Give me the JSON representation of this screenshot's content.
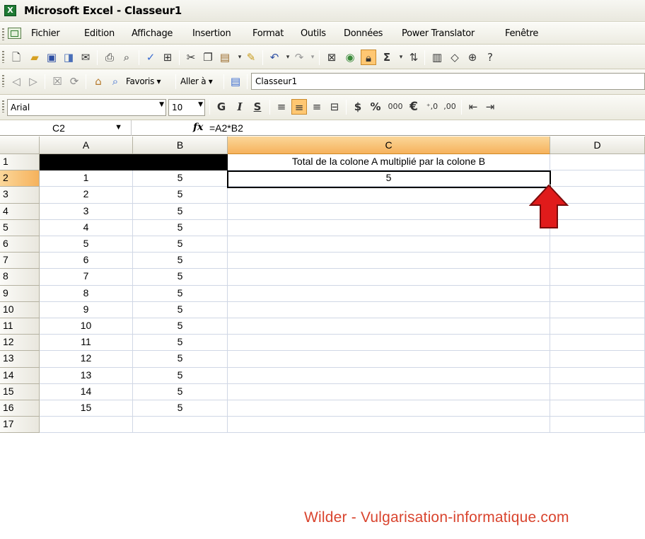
{
  "window": {
    "title": "Microsoft Excel - Classeur1"
  },
  "menu": {
    "items": [
      "Fichier",
      "Edition",
      "Affichage",
      "Insertion",
      "Format",
      "Outils",
      "Données",
      "Power Translator",
      "Fenêtre"
    ]
  },
  "web_toolbar": {
    "favoris": "Favoris ▾",
    "aller": "Aller à ▾",
    "address": "Classeur1"
  },
  "format_toolbar": {
    "font": "Arial",
    "size": "10",
    "bold": "G",
    "italic": "I",
    "underline": "S",
    "currency": "$",
    "percent": "%",
    "thousands": "000",
    "euro": "€"
  },
  "formula_bar": {
    "cell_ref": "C2",
    "fx": "fx",
    "formula": "=A2*B2"
  },
  "sheet": {
    "columns": [
      "A",
      "B",
      "C",
      "D"
    ],
    "rows": [
      {
        "n": "1",
        "a": "",
        "b": "",
        "c": "Total de la colone A multiplié par la colone B"
      },
      {
        "n": "2",
        "a": "1",
        "b": "5",
        "c": "5"
      },
      {
        "n": "3",
        "a": "2",
        "b": "5",
        "c": ""
      },
      {
        "n": "4",
        "a": "3",
        "b": "5",
        "c": ""
      },
      {
        "n": "5",
        "a": "4",
        "b": "5",
        "c": ""
      },
      {
        "n": "6",
        "a": "5",
        "b": "5",
        "c": ""
      },
      {
        "n": "7",
        "a": "6",
        "b": "5",
        "c": ""
      },
      {
        "n": "8",
        "a": "7",
        "b": "5",
        "c": ""
      },
      {
        "n": "9",
        "a": "8",
        "b": "5",
        "c": ""
      },
      {
        "n": "10",
        "a": "9",
        "b": "5",
        "c": ""
      },
      {
        "n": "11",
        "a": "10",
        "b": "5",
        "c": ""
      },
      {
        "n": "12",
        "a": "11",
        "b": "5",
        "c": ""
      },
      {
        "n": "13",
        "a": "12",
        "b": "5",
        "c": ""
      },
      {
        "n": "14",
        "a": "13",
        "b": "5",
        "c": ""
      },
      {
        "n": "15",
        "a": "14",
        "b": "5",
        "c": ""
      },
      {
        "n": "16",
        "a": "15",
        "b": "5",
        "c": ""
      },
      {
        "n": "17",
        "a": "",
        "b": "",
        "c": ""
      }
    ]
  },
  "watermark": "Wilder - Vulgarisation-informatique.com",
  "colors": {
    "selected_header": "#f6b25c",
    "arrow": "#e01b1b",
    "watermark": "#d9442e"
  }
}
